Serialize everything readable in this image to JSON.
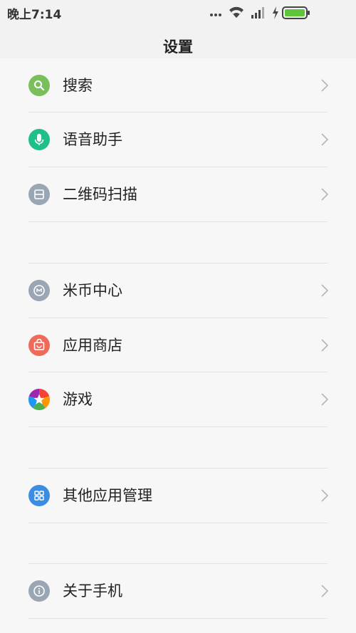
{
  "status_bar": {
    "time": "晚上7:14",
    "icons": [
      "more-dots-icon",
      "wifi-icon",
      "signal-icon",
      "charging-icon",
      "battery-icon"
    ]
  },
  "header": {
    "title": "设置"
  },
  "groups": [
    {
      "items": [
        {
          "label": "搜索",
          "icon": "search-icon",
          "color": "#7ac05a"
        },
        {
          "label": "语音助手",
          "icon": "microphone-icon",
          "color": "#1fbf8a"
        },
        {
          "label": "二维码扫描",
          "icon": "qr-scan-icon",
          "color": "#9aa6b4"
        }
      ]
    },
    {
      "items": [
        {
          "label": "米币中心",
          "icon": "mi-coin-icon",
          "color": "#9aa6b4"
        },
        {
          "label": "应用商店",
          "icon": "app-store-icon",
          "color": "#f06a5a"
        },
        {
          "label": "游戏",
          "icon": "game-star-icon",
          "color": "multicolor"
        }
      ]
    },
    {
      "items": [
        {
          "label": "其他应用管理",
          "icon": "apps-grid-icon",
          "color": "#3a8de0"
        }
      ]
    },
    {
      "items": [
        {
          "label": "关于手机",
          "icon": "info-icon",
          "color": "#9aa6b4"
        }
      ]
    }
  ]
}
